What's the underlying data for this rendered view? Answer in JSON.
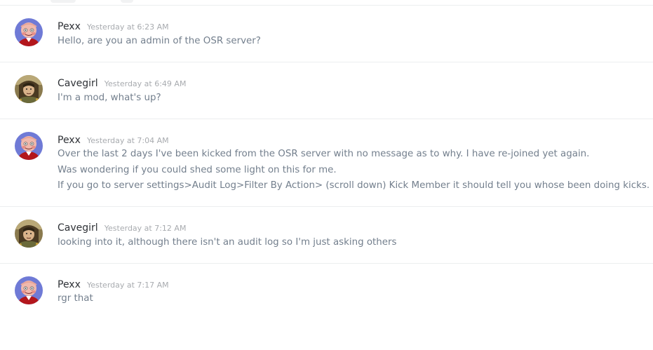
{
  "messages": [
    {
      "author": "Pexx",
      "avatar_icon": "pexx-avatar",
      "timestamp": "Yesterday at 6:23 AM",
      "lines": [
        "Hello, are you an admin of the OSR server?"
      ]
    },
    {
      "author": "Cavegirl",
      "avatar_icon": "cavegirl-avatar",
      "timestamp": "Yesterday at 6:49 AM",
      "lines": [
        "I'm a mod, what's up?"
      ]
    },
    {
      "author": "Pexx",
      "avatar_icon": "pexx-avatar",
      "timestamp": "Yesterday at 7:04 AM",
      "lines": [
        "Over the last 2 days I've been kicked from the OSR server with no message as to why. I have re-joined yet again.",
        "Was wondering if you could shed some light on this for me.",
        "If you go to server settings>Audit Log>Filter By Action> (scroll down) Kick Member it should tell you whose been doing kicks."
      ]
    },
    {
      "author": "Cavegirl",
      "avatar_icon": "cavegirl-avatar",
      "timestamp": "Yesterday at 7:12 AM",
      "lines": [
        "looking into it, although there isn't an audit log so I'm just asking others"
      ]
    },
    {
      "author": "Pexx",
      "avatar_icon": "pexx-avatar",
      "timestamp": "Yesterday at 7:17 AM",
      "lines": [
        "rgr that"
      ]
    }
  ],
  "colors": {
    "username": "#2e3136",
    "timestamp": "#a8abaf",
    "message_text": "#737f8d",
    "divider": "#eceeef",
    "pexx_avatar_bg": "#6f7ad6",
    "cavegirl_avatar_bg": "#8a7a4e"
  }
}
